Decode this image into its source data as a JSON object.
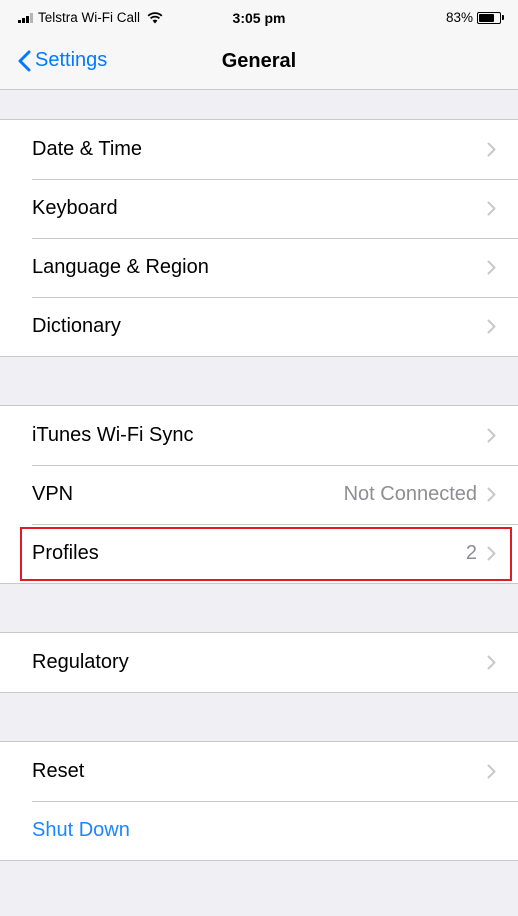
{
  "status_bar": {
    "carrier": "Telstra Wi-Fi Call",
    "time": "3:05 pm",
    "battery_percent": "83%",
    "battery_level": 0.83,
    "signal_icon": "signal-bars-icon",
    "wifi_icon": "wifi-icon"
  },
  "nav": {
    "back_label": "Settings",
    "title": "General"
  },
  "sections": [
    {
      "rows": [
        {
          "label": "Date & Time"
        },
        {
          "label": "Keyboard"
        },
        {
          "label": "Language & Region"
        },
        {
          "label": "Dictionary"
        }
      ]
    },
    {
      "rows": [
        {
          "label": "iTunes Wi-Fi Sync"
        },
        {
          "label": "VPN",
          "value": "Not Connected"
        },
        {
          "label": "Profiles",
          "value": "2",
          "highlighted": true
        }
      ]
    },
    {
      "rows": [
        {
          "label": "Regulatory"
        }
      ]
    },
    {
      "rows": [
        {
          "label": "Reset"
        },
        {
          "label": "Shut Down",
          "accent": true
        }
      ]
    }
  ],
  "colors": {
    "accent": "#007aff",
    "highlight_border": "#e01b24",
    "grouped_background": "#efeff4"
  }
}
